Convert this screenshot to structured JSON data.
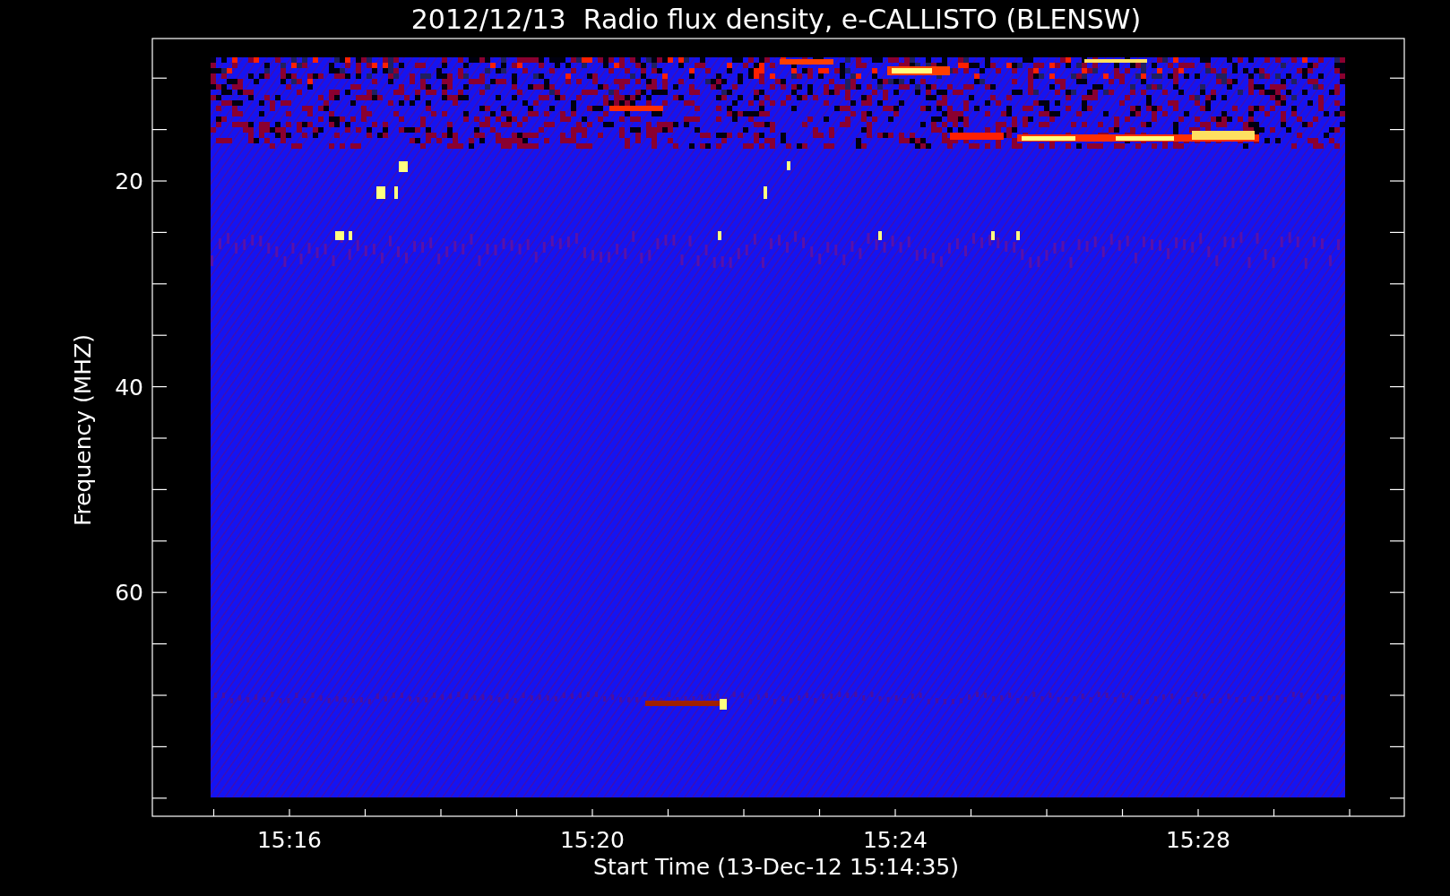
{
  "title": "2012/12/13  Radio flux density, e-CALLISTO (BLENSW)",
  "plot": {
    "ylabel": "Frequency (MHZ)",
    "xlabel": "Start Time (13-Dec-12 15:14:35)",
    "yticks": [
      "20",
      "40",
      "60"
    ],
    "xticks": [
      "15:16",
      "15:20",
      "15:24",
      "15:28"
    ]
  }
}
